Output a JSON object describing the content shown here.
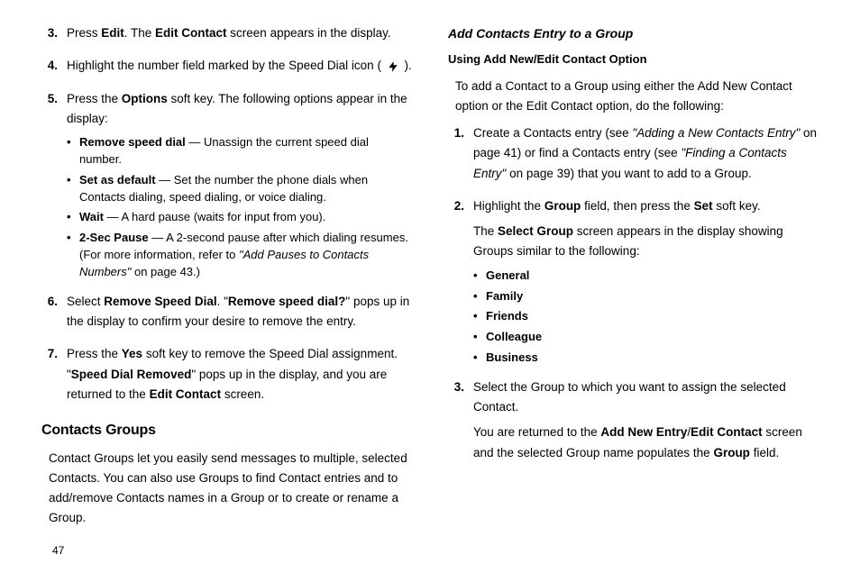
{
  "left": {
    "step3": {
      "num": "3.",
      "t1": "Press ",
      "t2": "Edit",
      "t3": ". The ",
      "t4": "Edit Contact",
      "t5": " screen appears in the display."
    },
    "step4": {
      "num": "4.",
      "t1": "Highlight the number field marked by the Speed Dial icon (",
      "t2": ")."
    },
    "step5": {
      "num": "5.",
      "t1": "Press the ",
      "t2": "Options",
      "t3": " soft key. The following options appear in the display:",
      "b1a": "Remove speed dial",
      "b1b": " — Unassign the current speed dial number.",
      "b2a": "Set as default",
      "b2b": " — Set the number the phone dials when Contacts dialing, speed dialing, or voice dialing.",
      "b3a": "Wait",
      "b3b": " — A hard pause (waits for input from you).",
      "b4a": "2-Sec Pause",
      "b4b": " — A 2-second pause after which dialing resumes. (For more information, refer to ",
      "b4c": "\"Add Pauses to Contacts Numbers\"",
      "b4d": "  on page 43.)"
    },
    "step6": {
      "num": "6.",
      "t1": "Select ",
      "t2": "Remove Speed Dial",
      "t3": ". \"",
      "t4": "Remove speed dial?",
      "t5": "\" pops up in the display to confirm your desire to remove the entry."
    },
    "step7": {
      "num": "7.",
      "t1": "Press the ",
      "t2": "Yes",
      "t3": " soft key to remove the Speed Dial assignment. \"",
      "t4": "Speed Dial Removed",
      "t5": "\" pops up in the display, and you are returned to the ",
      "t6": "Edit Contact",
      "t7": " screen."
    },
    "h_cg": "Contacts Groups",
    "cg_body": "Contact Groups let you easily send messages to multiple, selected Contacts. You can also use Groups to find Contact entries and to add/remove Contacts names in a Group or to create or rename a Group."
  },
  "right": {
    "h1": "Add Contacts Entry to a Group",
    "h2": "Using Add New/Edit Contact Option",
    "intro": "To add a Contact to a Group using either the Add New Contact option or the Edit Contact option, do the following:",
    "s1": {
      "num": "1.",
      "t1": "Create a Contacts entry (see ",
      "t2": "\"Adding a New Contacts Entry\"",
      "t3": " on page 41) or find a Contacts entry (see ",
      "t4": "\"Finding a Contacts Entry\"",
      "t5": " on page 39) that you want to add to a Group."
    },
    "s2": {
      "num": "2.",
      "t1": "Highlight the ",
      "t2": "Group",
      "t3": " field, then press the ",
      "t4": "Set",
      "t5": " soft key.",
      "p2a": "The ",
      "p2b": "Select Group",
      "p2c": " screen appears in the display showing Groups similar to the following:",
      "g1": "General",
      "g2": "Family",
      "g3": "Friends",
      "g4": "Colleague",
      "g5": "Business"
    },
    "s3": {
      "num": "3.",
      "t1": "Select the Group to which you want to assign the selected Contact.",
      "p2a": "You are returned to the ",
      "p2b": "Add New Entry",
      "p2c": "/",
      "p2d": "Edit Contact",
      "p2e": " screen and the selected Group name populates the ",
      "p2f": "Group",
      "p2g": " field."
    }
  },
  "page": "47"
}
